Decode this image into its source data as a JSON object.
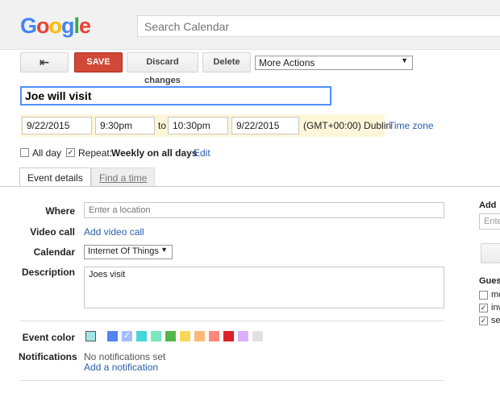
{
  "header": {
    "logo": "Google",
    "search_placeholder": "Search Calendar"
  },
  "toolbar": {
    "save": "SAVE",
    "discard": "Discard changes",
    "delete": "Delete",
    "more_actions": "More Actions"
  },
  "event": {
    "title": "Joe will visit",
    "start_date": "9/22/2015",
    "start_time": "9:30pm",
    "to": "to",
    "end_time": "10:30pm",
    "end_date": "9/22/2015",
    "timezone": "(GMT+00:00) Dublin",
    "timezone_link": "Time zone",
    "all_day_label": "All day",
    "all_day": false,
    "repeat_label": "Repeat:",
    "repeat_value": "Weekly on all days",
    "repeat_edit": "Edit",
    "repeat": true
  },
  "tabs": [
    "Event details",
    "Find a time"
  ],
  "details": {
    "where_label": "Where",
    "where_placeholder": "Enter a location",
    "video_label": "Video call",
    "video_link": "Add video call",
    "calendar_label": "Calendar",
    "calendar_value": "Internet Of Things",
    "description_label": "Description",
    "description_value": "Joes visit",
    "color_label": "Event color",
    "notifications_label": "Notifications",
    "notifications_value": "No notifications set",
    "add_notification": "Add a notification"
  },
  "colors": [
    "#a4e5e8",
    "#5484ed",
    "#a4bdfc",
    "#46d6db",
    "#7ae7bf",
    "#51b749",
    "#fbd75b",
    "#ffb878",
    "#ff887c",
    "#dc2127",
    "#dbadff",
    "#e1e1e1"
  ],
  "right_panel": {
    "add_label": "Add",
    "enter_placeholder": "Ente",
    "guests_label": "Gues",
    "rows": [
      "mo",
      "inv",
      "se"
    ]
  }
}
